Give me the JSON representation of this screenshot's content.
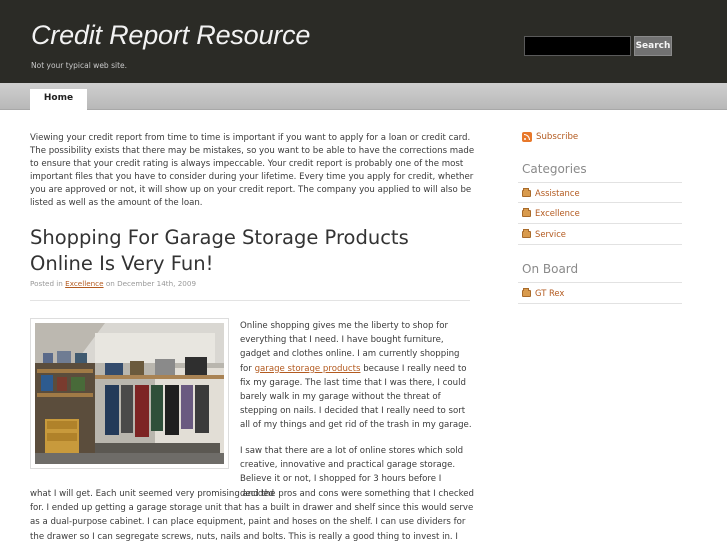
{
  "site": {
    "title": "Credit Report Resource",
    "tagline": "Not your typical web site."
  },
  "search": {
    "value": "",
    "button_label": "Search"
  },
  "nav": {
    "items": [
      {
        "label": "Home",
        "active": true
      }
    ]
  },
  "intro": {
    "text": "Viewing your credit report from time to time is important if you want to apply for a loan or credit card. The possibility exists that there may be mistakes, so you want to be able to have the corrections made to ensure that your credit rating is always impeccable. Your credit report is probably one of the most important files that you have to consider during your lifetime. Every time you apply for credit, whether you are approved or not, it will show up on your credit report. The company you applied to will also be listed as well as the amount of the loan."
  },
  "post": {
    "title": "Shopping For Garage Storage Products Online Is Very Fun!",
    "meta_prefix": "Posted in",
    "category": "Excellence",
    "meta_suffix": "on December 14th, 2009",
    "image_icon": "garage-photo",
    "para1_before": "Online shopping gives me the liberty to shop for everything that I need. I have bought furniture, gadget and clothes online. I am currently shopping for",
    "para1_link": "garage storage products",
    "para1_after": "because I really need to fix my garage. The last time that I was there, I could barely walk in my garage without the threat of stepping on nails. I decided that I really need to sort all of my things and get rid of the trash in my garage.",
    "para2_top": "I saw that there are a lot of online stores which sold creative, innovative and practical garage storage. Believe it or not, I shopped for 3 hours before I decided",
    "para2_bottom": "what I will get. Each unit seemed very promising and the pros and cons were something that I checked for. I ended up getting a garage storage unit that has a built in drawer and shelf since this would serve as a dual-purpose cabinet. I can place equipment, paint and hoses on the shelf. I can use dividers for the drawer so I can segregate screws, nuts, nails and bolts. This is really a good thing to invest in. I might even get a"
  },
  "sidebar": {
    "subscribe_label": "Subscribe",
    "categories_heading": "Categories",
    "categories": [
      {
        "label": "Assistance"
      },
      {
        "label": "Excellence"
      },
      {
        "label": "Service"
      }
    ],
    "onboard_heading": "On Board",
    "onboard": [
      {
        "label": "GT Rex"
      }
    ]
  },
  "colors": {
    "header_bg": "#2b2b26",
    "link": "#b35a1f",
    "nav_bg": "#c4c4c4"
  }
}
